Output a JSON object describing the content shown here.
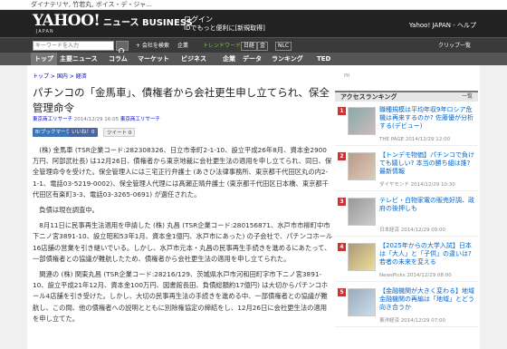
{
  "topstrip": {
    "text": "ダイナテリヤ, 竹若丸, ボイス・デ・ジャ..."
  },
  "header": {
    "logo": "YAHOO!",
    "logo_sub": "JAPAN",
    "brand": "ニュース BUSINESS",
    "login": "ログイン",
    "signup": "IDでもっと便利に[新規取得]",
    "right_link": "Yahoo! JAPAN - ヘルプ"
  },
  "toolbar": {
    "search_placeholder": "キーワードを入力",
    "follow": "+ 会社を検索",
    "company": "企業",
    "trend_label": "トレンドワード",
    "items": [
      "日経",
      "金",
      "NLC"
    ],
    "clip": "クリップ一覧"
  },
  "nav": {
    "items": [
      "トップ",
      "主要ニュース",
      "コラム",
      "マーケット",
      "ビジネス",
      "企業",
      "データ",
      "ランキング",
      "TED"
    ],
    "active_index": 0
  },
  "breadcrumb": {
    "path": "トップ > 国内 > 経済",
    "ad": "PR"
  },
  "article": {
    "title": "パチンコの「金馬車」、債権者から会社更生申し立てられ、保全管理命令",
    "source": "東京商工リサーチ",
    "date": "2014/12/29 16:05",
    "source_link": "東京商工リサーチ",
    "social": {
      "hatena": "B!ブックマーク",
      "like": "いいね！0",
      "tweet": "ツイート 0"
    },
    "paragraphs": [
      "(株) 金馬車 (TSR企業コード:282308326、日立市幸町2-1-10、設立平成26年8月、資本金2900万円、阿部武社長) は12月26日、債権者から東京地裁に会社更生法の適用を申し立てられ、同日、保全管理命令を受けた。保全管理人には三宅正行弁護士 (あさひ法律事務所、東京都千代田区丸の内2-1-1、電話03-5219-0002)、保全管理人代理には髙瀬正晴弁護士 (東京都千代田区日本橋、東京都千代田区有楽町3-3、電話03-3265-0691) が選任された。",
      "負債は現在調査中。",
      "8月11日に民事再生法適用を申請した (株) 丸昌 (TSR企業コード:280156871、水戸市市柳町中市下ニノ宮3891-10、設立昭和53年1月、資本金1億円、水戸市にあった) の子会社で、パチンコホール16店舗の営業を引き継いでいる。しかし、水戸市元本・丸昌の民事再生手続きを進めるにあたって、一部債権者との協議が難航したため、債権者から会社更生法の適用を申し立てられた。",
      "関連の (株) 関東丸昌 (TSR企業コード:28216/129、茨城県水戸市河和田町字市下ニノ宮3891-10、設立平成21年12月、資本金100万円、図書館長田、負債総額約17億円) は大切からパチンコホール4店舗を引き受けた。しかし、大切の民事再生法の手続きを進める中、一部債権者との協議が難航し、この間、他の債権者への説明とともに別除権協定の締結をし、12月26日に会社更生法の適用を申し立てた。"
    ]
  },
  "sidebar": {
    "title": "アクセスランキング",
    "more": "一覧",
    "ad_label": "PR",
    "items": [
      {
        "rank": "1",
        "title": "職種規模は平均年収9年ロシア危機は再来するのか? 佐藤優が分析する(デビュー)",
        "source": "THE PAGE 2014/12/29 12:00"
      },
      {
        "rank": "2",
        "title": "【トンデモ物価】パチンコで負けても嬉しい? 本当の勝ち組は誰? 最新情報",
        "source": "ダイヤモンド 2014/12/29 10:30"
      },
      {
        "rank": "3",
        "title": "テレビ・白物家電の販売好調、政府の後押しも",
        "source": "日本経済 2014/12/29 09:00"
      },
      {
        "rank": "4",
        "title": "【2025年からの大学入試】日本は「大人」と「子供」の違いは? 若者の未来を変える",
        "source": "NewsPicks 2014/12/29 08:00"
      },
      {
        "rank": "5",
        "title": "【金融機関が大きく変わる】地域金融機関の再編は「地域」とどう向き合うか",
        "source": "東洋経済 2014/12/29 07:00"
      }
    ]
  }
}
